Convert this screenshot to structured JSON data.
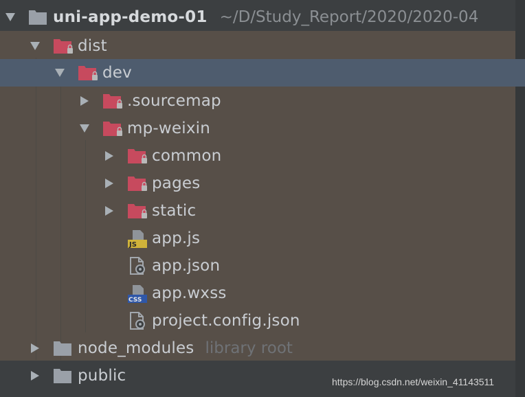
{
  "project": {
    "name": "uni-app-demo-01",
    "path": "~/D/Study_Report/2020/2020-04"
  },
  "items": [
    {
      "label": "dist"
    },
    {
      "label": "dev"
    },
    {
      "label": ".sourcemap"
    },
    {
      "label": "mp-weixin"
    },
    {
      "label": "common"
    },
    {
      "label": "pages"
    },
    {
      "label": "static"
    },
    {
      "label": "app.js",
      "icon": "js-file-icon",
      "badge": "JS"
    },
    {
      "label": "app.json",
      "icon": "json-file-icon"
    },
    {
      "label": "app.wxss",
      "icon": "css-file-icon",
      "badge": "CSS"
    },
    {
      "label": "project.config.json",
      "icon": "json-file-icon"
    },
    {
      "label": "node_modules",
      "suffix": "library root"
    },
    {
      "label": "public"
    }
  ],
  "watermark": "https://blog.csdn.net/weixin_41143511",
  "colors": {
    "background": "#3c3f41",
    "excluded_background": "#574f48",
    "selection": "#4e5c6e",
    "excluded_folder": "#c74a5e",
    "normal_folder": "#9aa0a8",
    "text": "#c9cdd2"
  }
}
